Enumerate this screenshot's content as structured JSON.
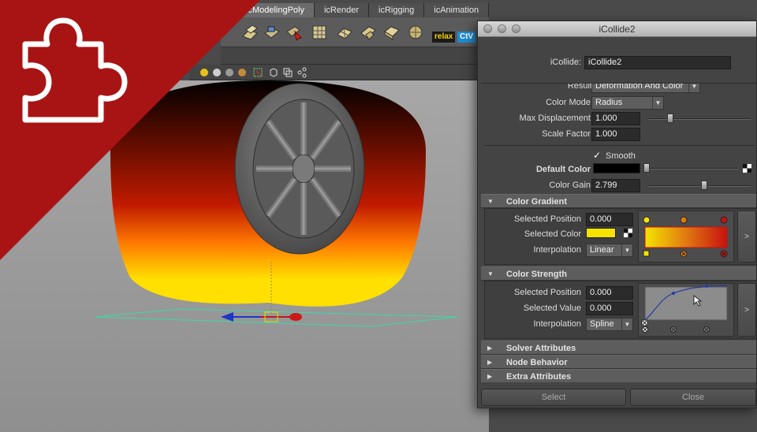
{
  "shelf": {
    "tabs": [
      {
        "label": "icModelingPoly",
        "active": true
      },
      {
        "label": "icRender",
        "active": false
      },
      {
        "label": "icRigging",
        "active": false
      },
      {
        "label": "icAnimation",
        "active": false
      }
    ],
    "relax_label": "relax",
    "ctv_label": "CtV"
  },
  "badge": {
    "icon": "puzzle-piece-icon",
    "color": "#a81414"
  },
  "dialog": {
    "title": "iCollide2",
    "node_label": "iCollide:",
    "node_value": "iCollide2",
    "result_label": "Result",
    "result_value": "Deformation And Color",
    "color_mode_label": "Color Mode",
    "color_mode_value": "Radius",
    "max_disp_label": "Max Displacement",
    "max_disp_value": "1.000",
    "scale_factor_label": "Scale Factor",
    "scale_factor_value": "1.000",
    "smooth_label": "Smooth",
    "smooth_checked": true,
    "default_color_label": "Default Color",
    "default_color_hex": "#000000",
    "color_gain_label": "Color Gain",
    "color_gain_value": "2.799",
    "sections": {
      "color_gradient": "Color Gradient",
      "color_strength": "Color Strength",
      "solver": "Solver Attributes",
      "node_behavior": "Node Behavior",
      "extra": "Extra Attributes"
    },
    "gradient": {
      "sel_pos_label": "Selected Position",
      "sel_pos_value": "0.000",
      "sel_color_label": "Selected Color",
      "sel_color_hex": "#f5e400",
      "interp_label": "Interpolation",
      "interp_value": "Linear",
      "expand_label": ">",
      "stops": [
        "#f5e400",
        "#e07a10",
        "#c81010"
      ]
    },
    "strength": {
      "sel_pos_label": "Selected Position",
      "sel_pos_value": "0.000",
      "sel_val_label": "Selected Value",
      "sel_val_value": "0.000",
      "interp_label": "Interpolation",
      "interp_value": "Spline",
      "expand_label": ">"
    },
    "select_button": "Select",
    "close_button": "Close"
  },
  "viewport": {
    "fire_colors": [
      "#000000",
      "#c01a00",
      "#ff7a00",
      "#ffe000"
    ],
    "wheel_color": "#6a6a6a",
    "plane_color": "#3fd8a8"
  }
}
